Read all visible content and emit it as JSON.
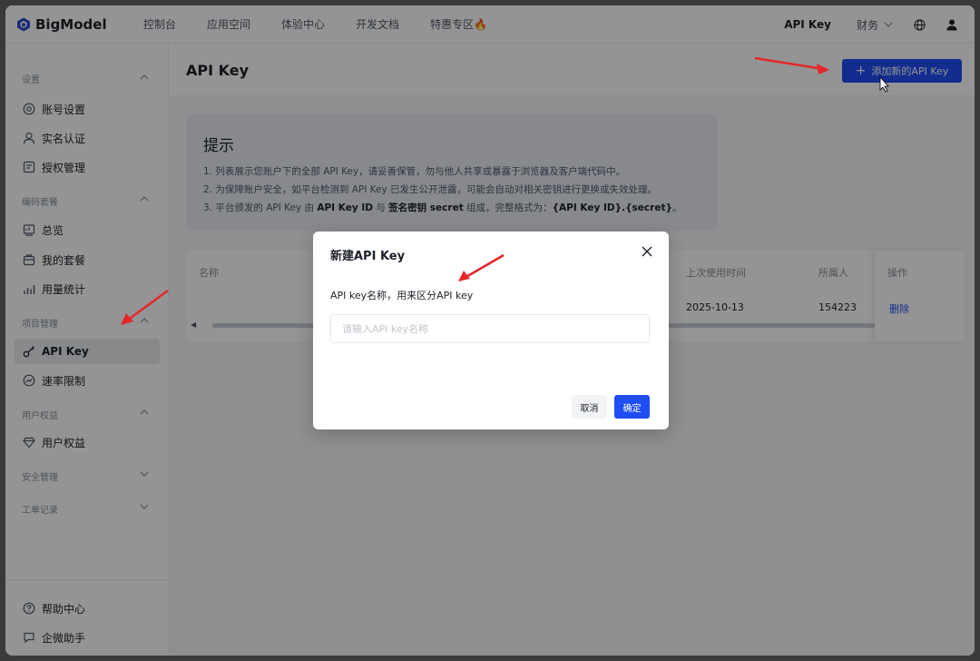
{
  "header": {
    "logo_text": "BigModel",
    "nav": [
      "控制台",
      "应用空间",
      "体验中心",
      "开发文档",
      "特惠专区"
    ],
    "fire_emoji": "🔥",
    "api_key_link": "API Key",
    "finance": "财务"
  },
  "sidebar": {
    "sections": [
      {
        "title": "设置",
        "items": [
          "账号设置",
          "实名认证",
          "授权管理"
        ]
      },
      {
        "title": "编码套餐",
        "items": [
          "总览",
          "我的套餐",
          "用量统计"
        ]
      },
      {
        "title": "项目管理",
        "items": [
          "API Key",
          "速率限制"
        ]
      },
      {
        "title": "用户权益",
        "items": [
          "用户权益"
        ]
      },
      {
        "title": "安全管理",
        "items": []
      },
      {
        "title": "工单记录",
        "items": []
      }
    ],
    "bottom": [
      "帮助中心",
      "企微助手"
    ],
    "active": "API Key"
  },
  "main": {
    "page_title": "API Key",
    "add_button": "添加新的API Key",
    "tip": {
      "title": "提示",
      "line1": "1. 列表展示您账户下的全部 API Key，请妥善保管，勿与他人共享或暴露于浏览器及客户端代码中。",
      "line2": "2. 为保障账户安全，如平台检测到 API Key 已发生公开泄露，可能会自动对相关密钥进行更换或失效处理。",
      "line3_a": "3. 平台颁发的 API Key 由 ",
      "line3_b": "API Key ID",
      "line3_c": " 与 ",
      "line3_d": "签名密钥 secret",
      "line3_e": " 组成，完整格式为：",
      "line3_f": "{API Key ID}.{secret}",
      "line3_g": "。"
    },
    "table": {
      "headers": {
        "name": "名称",
        "last_used": "上次使用时间",
        "owner": "所属人",
        "action": "操作"
      },
      "rows": [
        {
          "last_used": "2025-10-13",
          "owner": "154223",
          "action": "删除"
        }
      ]
    }
  },
  "modal": {
    "title": "新建API Key",
    "label": "API key名称，用来区分API key",
    "input_placeholder": "请输入API key名称",
    "input_value": "",
    "cancel": "取消",
    "confirm": "确定"
  },
  "colors": {
    "accent": "#1f4ef5",
    "annotation_arrow": "#e5262a"
  }
}
